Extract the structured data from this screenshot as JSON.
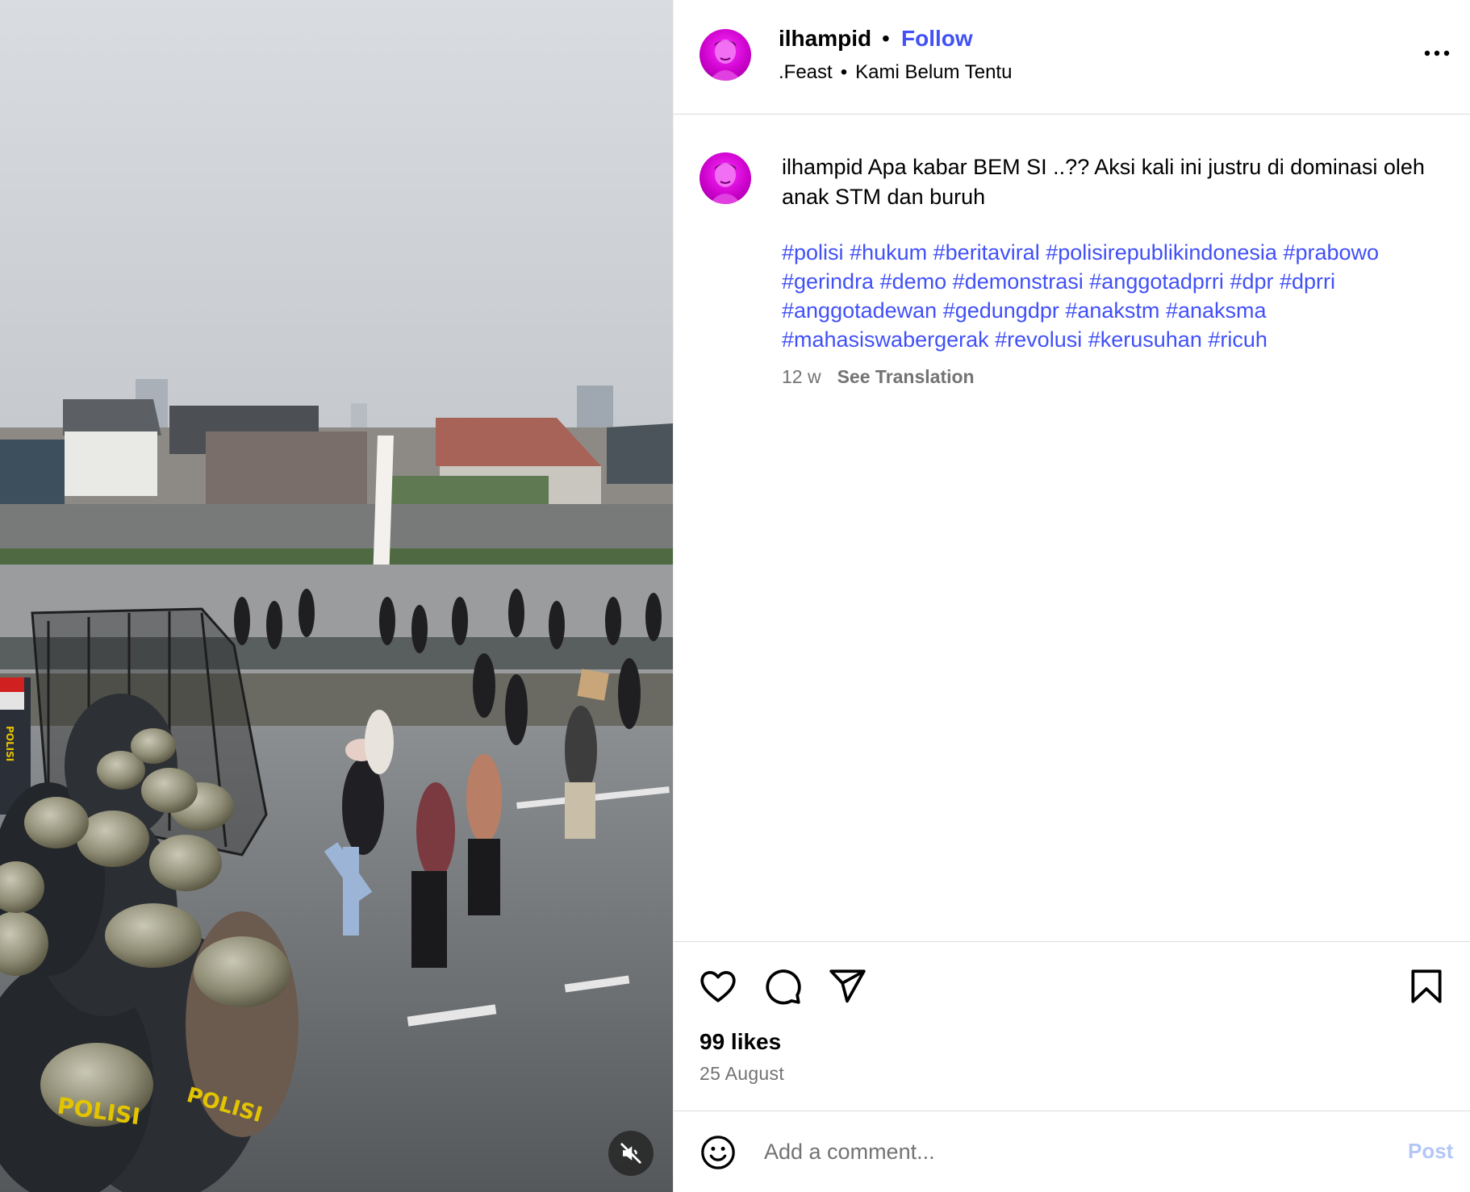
{
  "media": {
    "mute_icon": "speaker-muted-icon",
    "helmet_text": "POLISI",
    "fence_banner_text": "POLISI"
  },
  "header": {
    "username": "ilhampid",
    "separator": "•",
    "follow_label": "Follow",
    "audio_artist": ".Feast",
    "audio_separator": "•",
    "audio_track": "Kami Belum Tentu",
    "more_icon": "more-options-icon"
  },
  "caption": {
    "username": "ilhampid",
    "text": "Apa kabar BEM SI ..?? Aksi kali ini justru di dominasi oleh anak STM dan buruh",
    "hashtags": [
      "#polisi",
      "#hukum",
      "#beritaviral",
      "#polisirepublikindonesia",
      "#prabowo",
      "#gerindra",
      "#demo",
      "#demonstrasi",
      "#anggotadprri",
      "#dpr",
      "#dprri",
      "#anggotadewan",
      "#gedungdpr",
      "#anakstm",
      "#anaksma",
      "#mahasiswabergerak",
      "#revolusi",
      "#kerusuhan",
      "#ricuh"
    ],
    "age": "12 w",
    "translate_label": "See Translation"
  },
  "actions": {
    "like_icon": "heart-icon",
    "comment_icon": "comment-icon",
    "share_icon": "share-icon",
    "save_icon": "bookmark-icon",
    "likes_text": "99 likes",
    "date_text": "25 August"
  },
  "comment": {
    "emoji_icon": "emoji-icon",
    "placeholder": "Add a comment...",
    "post_label": "Post"
  },
  "colors": {
    "link_blue": "#4150f7",
    "post_disabled": "#b3c6f7",
    "meta_gray": "#737373",
    "avatar_magenta": "#d400d4"
  }
}
